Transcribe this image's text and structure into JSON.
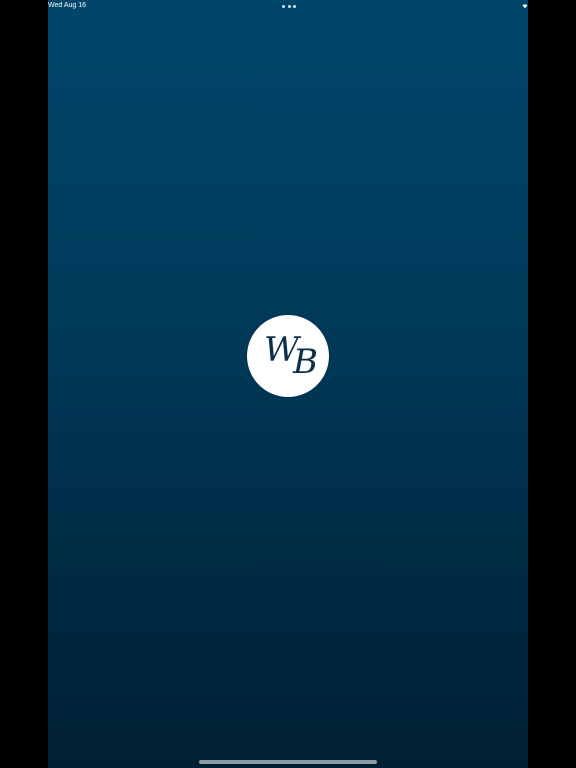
{
  "status_bar": {
    "time": "Wed Aug 16",
    "wifi_icon": "wifi-icon",
    "multitask_icon": "ellipsis-icon"
  },
  "splash": {
    "logo_letter_1": "W",
    "logo_letter_2": "B",
    "background_top": "#00466a",
    "background_bottom": "#001f33",
    "logo_color": "#0c2f4a"
  }
}
